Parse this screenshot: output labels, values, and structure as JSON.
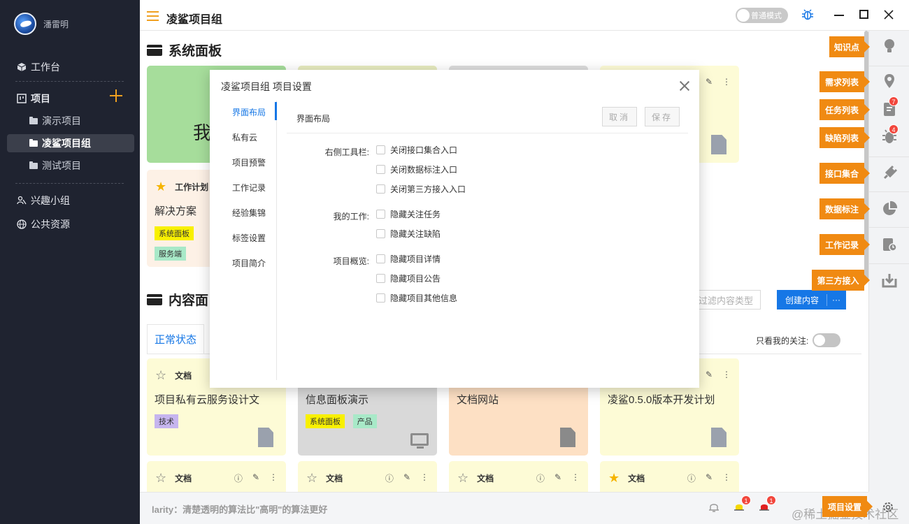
{
  "sidebar": {
    "username": "潘雷明",
    "workbench": "工作台",
    "projects": "项目",
    "sub_items": [
      "演示项目",
      "凌鲨项目组",
      "测试项目"
    ],
    "interest": "兴趣小组",
    "public": "公共资源"
  },
  "topbar": {
    "title": "凌鲨项目组",
    "mode_label": "普通模式"
  },
  "main": {
    "section1_title": "系统面板",
    "section2_title": "内容面",
    "panel_card_text": "我",
    "work_card": {
      "head": "工作计划",
      "title": "解决方案",
      "tags": [
        "系统面板",
        "服务端"
      ]
    },
    "tab_label": "正常状态",
    "filter_placeholder": "过滤内容类型",
    "create_label": "创建内容",
    "create_more": "···",
    "only_mine": "只看我的关注:",
    "cards": [
      {
        "head": "文档",
        "title": "项目私有云服务设计文",
        "tags": [
          "技术"
        ]
      },
      {
        "title": "信息面板演示",
        "tags": [
          "系统面板",
          "产品"
        ]
      },
      {
        "title": "文档网站",
        "tags": []
      },
      {
        "title": "凌鲨0.5.0版本开发计划",
        "tags": []
      }
    ],
    "bottom_cards": [
      "文档",
      "文档",
      "文档",
      "文档"
    ]
  },
  "bottombar": {
    "quote": "larity：清楚透明的算法比\"高明\"的算法更好",
    "badge1": "1",
    "badge2": "1",
    "watermark": "@稀土掘金技术社区"
  },
  "right_toolbar": {
    "tips": [
      "知识点",
      "需求列表",
      "任务列表",
      "缺陷列表",
      "接口集合",
      "数据标注",
      "工作记录",
      "第三方接入",
      "项目设置"
    ],
    "task_badge": "7",
    "bug_badge": "4"
  },
  "modal": {
    "title": "凌鲨项目组 项目设置",
    "nav": [
      "界面布局",
      "私有云",
      "项目预警",
      "工作记录",
      "经验集锦",
      "标签设置",
      "项目简介"
    ],
    "header": "界面布局",
    "cancel": "取消",
    "save": "保存",
    "groups": [
      {
        "label": "右侧工具栏:",
        "options": [
          "关闭接口集合入口",
          "关闭数据标注入口",
          "关闭第三方接入入口"
        ]
      },
      {
        "label": "我的工作:",
        "options": [
          "隐藏关注任务",
          "隐藏关注缺陷"
        ]
      },
      {
        "label": "项目概览:",
        "options": [
          "隐藏项目详情",
          "隐藏项目公告",
          "隐藏项目其他信息"
        ]
      }
    ]
  },
  "colors": {
    "accent": "#1677e6",
    "orange": "#f08a12",
    "sidebar_bg": "#1f2330",
    "card_yellow": "#fdfbd6",
    "card_green": "#a6dd9b",
    "card_gray": "#d9d9d9",
    "card_orange": "#fde0c4",
    "tag_yellow": "#f8f000",
    "tag_purple": "#c6b5ee",
    "tag_green": "#a8e9c8"
  }
}
